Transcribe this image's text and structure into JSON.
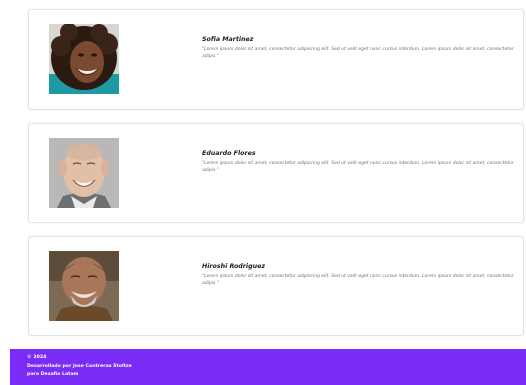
{
  "testimonials": [
    {
      "name": "Sofia Martinez",
      "quote": "\"Lorem ipsum dolor sit amet, consectetur adipiscing elit. Sed ut velit eget nunc cursus interdum. Lorem ipsum dolor sit amet, consectetur adipis.\"",
      "avatar_icon": "portrait-smiling-woman"
    },
    {
      "name": "Eduardo Flores",
      "quote": "\"Lorem ipsum dolor sit amet, consectetur adipiscing elit. Sed ut velit eget nunc cursus interdum. Lorem ipsum dolor sit amet, consectetur adipis.\"",
      "avatar_icon": "portrait-smiling-elderly-man"
    },
    {
      "name": "Hiroshi Rodriguez",
      "quote": "\"Lorem ipsum dolor sit amet, consectetur adipiscing elit. Sed ut velit eget nunc cursus interdum. Lorem ipsum dolor sit amet, consectetur adipis.\"",
      "avatar_icon": "portrait-smiling-old-man"
    }
  ],
  "footer": {
    "year": "© 2024",
    "credit": "Desarrollado por Jose Contreras Stoltze",
    "platform": "para Desafio Latam"
  },
  "colors": {
    "footer_background": "#7b2bf6",
    "card_border": "#e2e2e2"
  }
}
